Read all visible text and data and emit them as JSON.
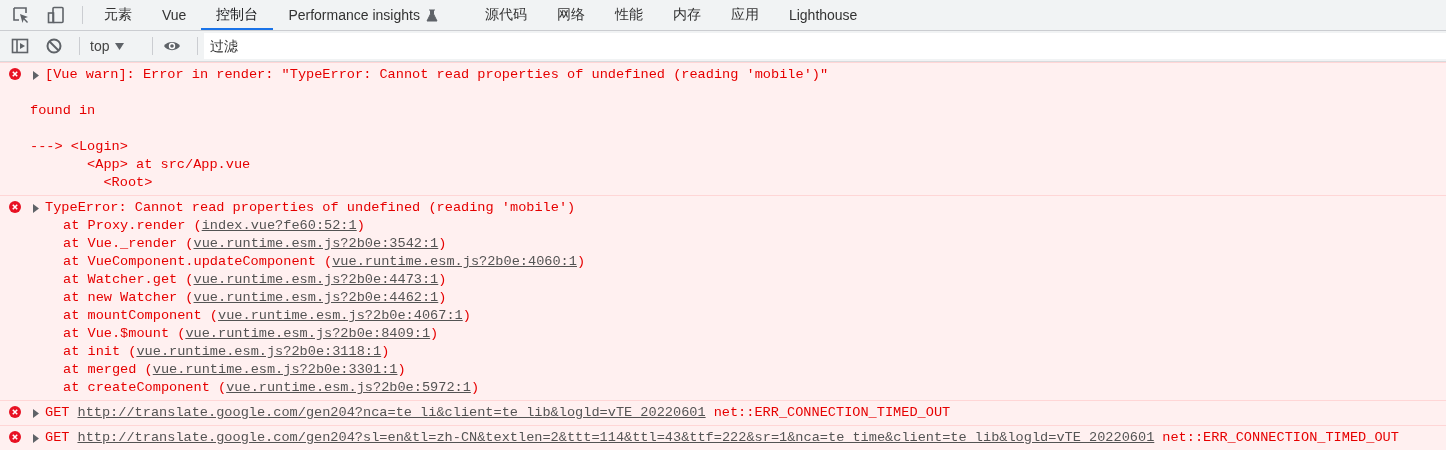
{
  "tabs": [
    {
      "label": "元素",
      "selected": false
    },
    {
      "label": "Vue",
      "selected": false
    },
    {
      "label": "控制台",
      "selected": true
    },
    {
      "label": "Performance insights",
      "selected": false,
      "experimental": true
    },
    {
      "label": "源代码",
      "selected": false
    },
    {
      "label": "网络",
      "selected": false
    },
    {
      "label": "性能",
      "selected": false
    },
    {
      "label": "内存",
      "selected": false
    },
    {
      "label": "应用",
      "selected": false
    },
    {
      "label": "Lighthouse",
      "selected": false
    }
  ],
  "toolbar": {
    "context": "top",
    "filter": {
      "placeholder": "过滤"
    }
  },
  "messages": [
    {
      "kind": "text",
      "is_error": true,
      "expanded": false,
      "summary": "[Vue warn]: Error in render: \"TypeError: Cannot read properties of undefined (reading 'mobile')\"",
      "paragraphs": [
        "found in",
        "---> <Login>\n       <App> at src/App.vue\n         <Root>"
      ]
    },
    {
      "kind": "stack",
      "is_error": true,
      "expanded": false,
      "summary": "TypeError: Cannot read properties of undefined (reading 'mobile')",
      "frames": [
        {
          "before": "at Proxy.render (",
          "link": "index.vue?fe60:52:1",
          "after": ")"
        },
        {
          "before": "at Vue._render (",
          "link": "vue.runtime.esm.js?2b0e:3542:1",
          "after": ")"
        },
        {
          "before": "at VueComponent.updateComponent (",
          "link": "vue.runtime.esm.js?2b0e:4060:1",
          "after": ")"
        },
        {
          "before": "at Watcher.get (",
          "link": "vue.runtime.esm.js?2b0e:4473:1",
          "after": ")"
        },
        {
          "before": "at new Watcher (",
          "link": "vue.runtime.esm.js?2b0e:4462:1",
          "after": ")"
        },
        {
          "before": "at mountComponent (",
          "link": "vue.runtime.esm.js?2b0e:4067:1",
          "after": ")"
        },
        {
          "before": "at Vue.$mount (",
          "link": "vue.runtime.esm.js?2b0e:8409:1",
          "after": ")"
        },
        {
          "before": "at init (",
          "link": "vue.runtime.esm.js?2b0e:3118:1",
          "after": ")"
        },
        {
          "before": "at merged (",
          "link": "vue.runtime.esm.js?2b0e:3301:1",
          "after": ")"
        },
        {
          "before": "at createComponent (",
          "link": "vue.runtime.esm.js?2b0e:5972:1",
          "after": ")"
        }
      ]
    },
    {
      "kind": "network",
      "is_error": true,
      "expanded": false,
      "method": "GET",
      "url": "http://translate.google.com/gen204?nca=te_li&client=te_lib&logld=vTE_20220601",
      "error": "net::ERR_CONNECTION_TIMED_OUT"
    },
    {
      "kind": "network",
      "is_error": true,
      "expanded": false,
      "method": "GET",
      "url": "http://translate.google.com/gen204?sl=en&tl=zh-CN&textlen=2&ttt=114&ttl=43&ttf=222&sr=1&nca=te_time&client=te_lib&logld=vTE_20220601",
      "error": "net::ERR_CONNECTION_TIMED_OUT"
    }
  ]
}
